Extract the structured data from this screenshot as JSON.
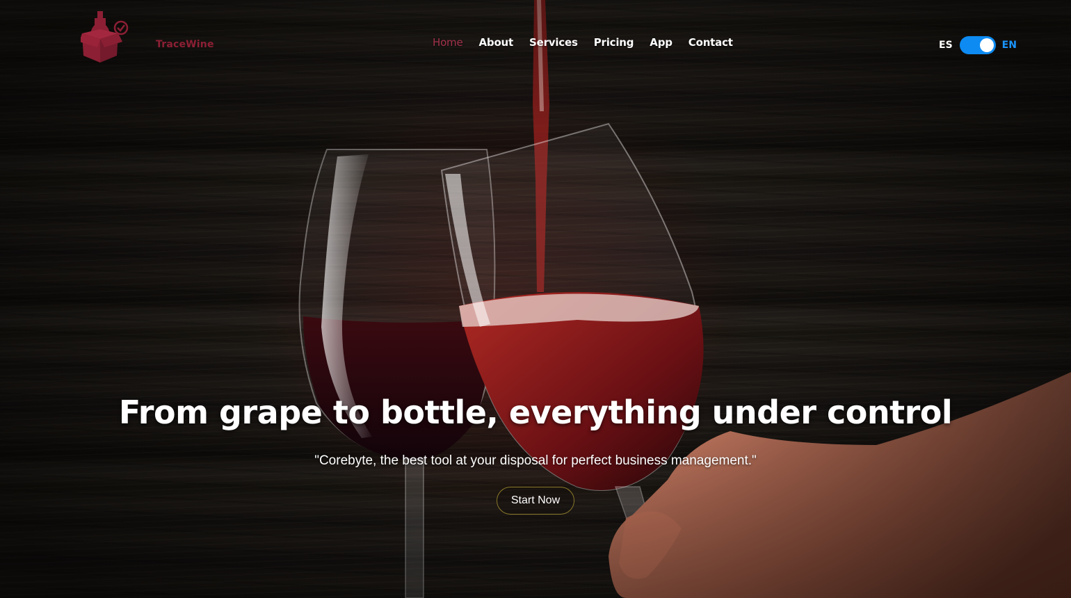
{
  "brand": {
    "name": "TraceWine",
    "logo_icon": "wine-box-check-icon",
    "color": "#8c1f34"
  },
  "nav": {
    "items": [
      {
        "label": "Home",
        "active": true
      },
      {
        "label": "About",
        "active": false
      },
      {
        "label": "Services",
        "active": false
      },
      {
        "label": "Pricing",
        "active": false
      },
      {
        "label": "App",
        "active": false
      },
      {
        "label": "Contact",
        "active": false
      }
    ],
    "active_color": "#a3324b"
  },
  "language": {
    "left_label": "ES",
    "right_label": "EN",
    "selected": "EN",
    "toggle_color": "#0d8bf2"
  },
  "hero": {
    "headline": "From grape to bottle, everything under control",
    "tagline": "\"Corebyte, the best tool at your disposal for perfect business management.\"",
    "cta_label": "Start Now",
    "cta_border_color": "#8a7a2a"
  }
}
